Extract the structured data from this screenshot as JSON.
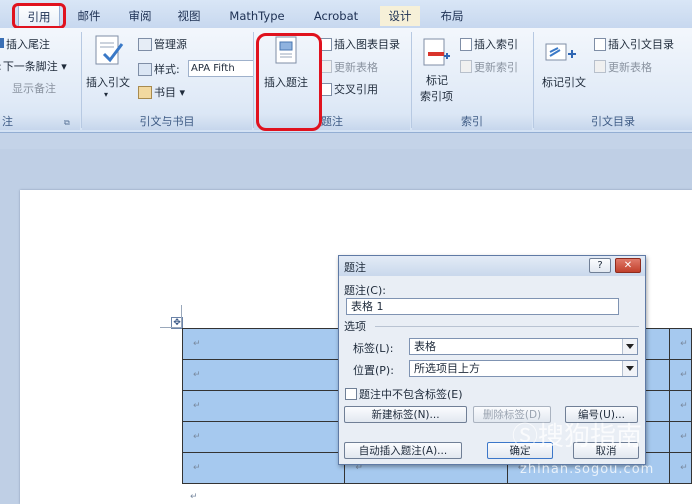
{
  "tabs": [
    "引用",
    "邮件",
    "审阅",
    "视图",
    "MathType",
    "Acrobat",
    "设计",
    "布局"
  ],
  "ribbon": {
    "footnotes": {
      "insert_endnote": "插入尾注",
      "next_footnote": "下一条脚注",
      "show_notes": "显示备注",
      "group_title": "注"
    },
    "citations": {
      "insert_citation": "插入引文",
      "manage_sources": "管理源",
      "style_label": "样式:",
      "style_value": "APA Fifth",
      "bibliography": "书目",
      "group_title": "引文与书目"
    },
    "captions": {
      "insert_caption": "插入题注",
      "insert_table_of_figures": "插入图表目录",
      "update_table": "更新表格",
      "cross_reference": "交叉引用",
      "group_title": "题注"
    },
    "index": {
      "mark_entry": "标记",
      "mark_entry_2": "索引项",
      "insert_index": "插入索引",
      "update_index": "更新索引",
      "group_title": "索引"
    },
    "toa": {
      "mark_citation": "标记引文",
      "insert_toa": "插入引文目录",
      "update_table": "更新表格",
      "group_title": "引文目录"
    }
  },
  "dialog": {
    "title": "题注",
    "caption_label": "题注(C):",
    "caption_value": "表格 1",
    "options_label": "选项",
    "label_label": "标签(L):",
    "label_value": "表格",
    "position_label": "位置(P):",
    "position_value": "所选项目上方",
    "exclude_label_text": "题注中不包含标签(E)",
    "new_label_button": "新建标签(N)...",
    "delete_label_button": "删除标签(D)",
    "numbering_button": "编号(U)...",
    "autocaption_button": "自动插入题注(A)...",
    "ok_button": "确定",
    "cancel_button": "取消",
    "help_glyph": "?",
    "close_glyph": "✕"
  },
  "document": {
    "table_cell_mark": "↵",
    "table_rows": [
      [
        "↵",
        "↵",
        "↵",
        "↵"
      ],
      [
        "↵",
        "↵",
        "↵",
        "↵"
      ],
      [
        "↵",
        "↵",
        "↵",
        "↵"
      ],
      [
        "↵",
        "↵",
        "↵",
        "↵"
      ],
      [
        "↵",
        "↵",
        "↵",
        "↵"
      ]
    ],
    "paragraph_mark": "↵",
    "move_handle": "✥"
  },
  "watermark": {
    "brand": "搜狗指南",
    "url": "zhinan.sogou.com"
  }
}
